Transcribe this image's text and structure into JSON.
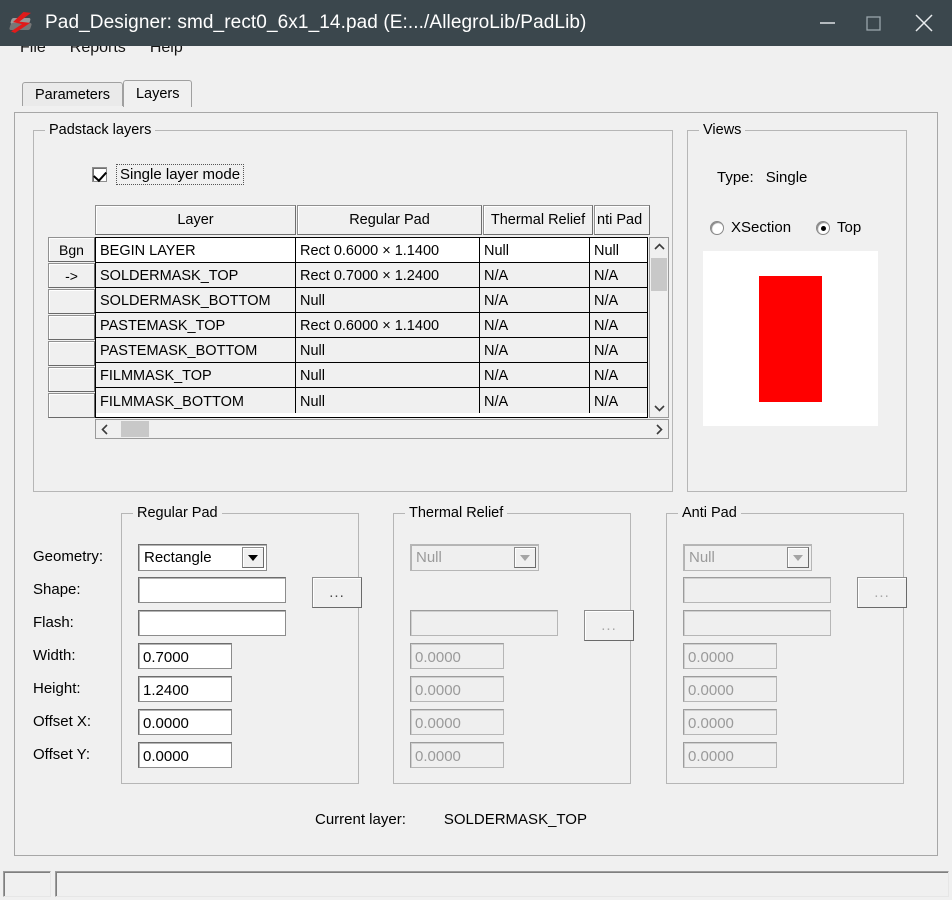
{
  "window": {
    "title": "Pad_Designer: smd_rect0_6x1_14.pad (E:.../AllegroLib/PadLib)",
    "icon": "allegro-pad-designer-icon",
    "minimize": "minimize-icon",
    "maximize": "maximize-icon",
    "close": "close-icon",
    "titlebar_color": "#3b474d"
  },
  "menu": {
    "items": [
      {
        "label": "File"
      },
      {
        "label": "Reports"
      },
      {
        "label": "Help"
      }
    ]
  },
  "tabs": [
    {
      "label": "Parameters",
      "active": false
    },
    {
      "label": "Layers",
      "active": true
    }
  ],
  "padstack": {
    "legend": "Padstack layers",
    "single_layer_mode": {
      "label": "Single layer mode",
      "checked": true
    },
    "columns": [
      "Layer",
      "Regular Pad",
      "Thermal Relief",
      "nti Pad"
    ],
    "row_buttons": [
      "Bgn",
      "->",
      "",
      "",
      "",
      "",
      ""
    ],
    "rows": [
      {
        "layer": "BEGIN LAYER",
        "regular_pad": "Rect 0.6000 × 1.1400",
        "thermal_relief": "Null",
        "anti_pad": "Null",
        "selected": true
      },
      {
        "layer": "SOLDERMASK_TOP",
        "regular_pad": "Rect 0.7000 × 1.2400",
        "thermal_relief": "N/A",
        "anti_pad": "N/A",
        "selected": false
      },
      {
        "layer": "SOLDERMASK_BOTTOM",
        "regular_pad": "Null",
        "thermal_relief": "N/A",
        "anti_pad": "N/A",
        "selected": false
      },
      {
        "layer": "PASTEMASK_TOP",
        "regular_pad": "Rect 0.6000 × 1.1400",
        "thermal_relief": "N/A",
        "anti_pad": "N/A",
        "selected": false
      },
      {
        "layer": "PASTEMASK_BOTTOM",
        "regular_pad": "Null",
        "thermal_relief": "N/A",
        "anti_pad": "N/A",
        "selected": false
      },
      {
        "layer": "FILMMASK_TOP",
        "regular_pad": "Null",
        "thermal_relief": "N/A",
        "anti_pad": "N/A",
        "selected": false
      },
      {
        "layer": "FILMMASK_BOTTOM",
        "regular_pad": "Null",
        "thermal_relief": "N/A",
        "anti_pad": "N/A",
        "selected": false
      }
    ],
    "scroll_up_icon": "chevron-up-icon",
    "scroll_down_icon": "chevron-down-icon",
    "scroll_left_icon": "chevron-left-icon",
    "scroll_right_icon": "chevron-right-icon"
  },
  "views": {
    "legend": "Views",
    "type_label": "Type:",
    "type_value": "Single",
    "options": [
      {
        "label": "XSection",
        "selected": false
      },
      {
        "label": "Top",
        "selected": true
      }
    ],
    "preview": {
      "background": "#ffffff",
      "pad_color": "#ff0000",
      "pad_shape": "rectangle"
    }
  },
  "field_labels": {
    "geometry": "Geometry:",
    "shape": "Shape:",
    "flash": "Flash:",
    "width": "Width:",
    "height": "Height:",
    "offset_x": "Offset X:",
    "offset_y": "Offset Y:"
  },
  "regular_pad": {
    "legend": "Regular Pad",
    "geometry": "Rectangle",
    "shape": "",
    "flash": "",
    "width": "0.7000",
    "height": "1.2400",
    "offset_x": "0.0000",
    "offset_y": "0.0000",
    "browse_label": "...",
    "enabled": true
  },
  "thermal_relief": {
    "legend": "Thermal Relief",
    "geometry": "Null",
    "flash": "",
    "width": "0.0000",
    "height": "0.0000",
    "offset_x": "0.0000",
    "offset_y": "0.0000",
    "browse_label": "...",
    "enabled": false
  },
  "anti_pad": {
    "legend": "Anti Pad",
    "geometry": "Null",
    "shape": "",
    "flash": "",
    "width": "0.0000",
    "height": "0.0000",
    "offset_x": "0.0000",
    "offset_y": "0.0000",
    "browse_label": "...",
    "enabled": false
  },
  "footer": {
    "current_layer_label": "Current layer:",
    "current_layer_value": "SOLDERMASK_TOP"
  },
  "statusbar": {
    "pane1": "",
    "pane2": ""
  }
}
